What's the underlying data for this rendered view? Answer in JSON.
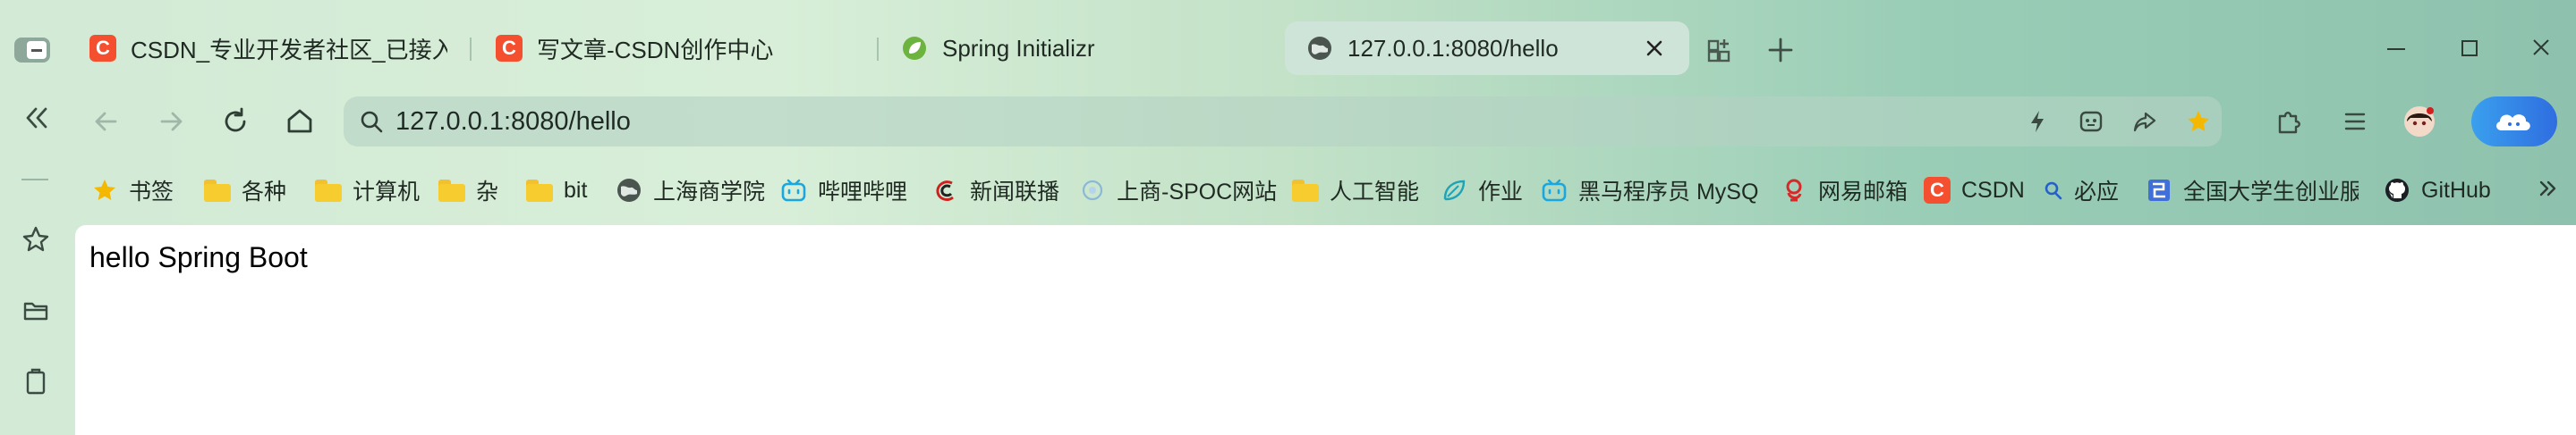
{
  "tabs": [
    {
      "label": "CSDN_专业开发者社区_已接入D",
      "icon": "csdn-icon",
      "active": false
    },
    {
      "label": "写文章-CSDN创作中心",
      "icon": "csdn-icon",
      "active": false
    },
    {
      "label": "Spring Initializr",
      "icon": "spring-leaf-icon",
      "active": false
    },
    {
      "label": "127.0.0.1:8080/hello",
      "icon": "globe-icon",
      "active": true
    }
  ],
  "csdn_letter": "C",
  "address_bar": {
    "url": "127.0.0.1:8080/hello"
  },
  "bookmarks": [
    {
      "label": "书签",
      "icon": "star-icon"
    },
    {
      "label": "各种",
      "icon": "folder-icon"
    },
    {
      "label": "计算机",
      "icon": "folder-icon"
    },
    {
      "label": "杂",
      "icon": "folder-icon"
    },
    {
      "label": "bit",
      "icon": "folder-icon"
    },
    {
      "label": "上海商学院",
      "icon": "globe-icon"
    },
    {
      "label": "哔哩哔哩",
      "icon": "bilibili-icon"
    },
    {
      "label": "新闻联播",
      "icon": "cctv-icon"
    },
    {
      "label": "上商-SPOC网站",
      "icon": "spoc-icon"
    },
    {
      "label": "人工智能",
      "icon": "folder-icon"
    },
    {
      "label": "作业",
      "icon": "leaf-icon"
    },
    {
      "label": "黑马程序员 MySQ",
      "icon": "bilibili-icon"
    },
    {
      "label": "网易邮箱",
      "icon": "netease-mail-icon"
    },
    {
      "label": "CSDN",
      "icon": "csdn-icon"
    },
    {
      "label": "必应",
      "icon": "search-icon"
    },
    {
      "label": "全国大学生创业服",
      "icon": "square-logo-icon"
    },
    {
      "label": "GitHub",
      "icon": "github-icon"
    }
  ],
  "page": {
    "content": "hello Spring Boot"
  },
  "colors": {
    "accent": "#2f6de0",
    "csdn": "#f4502f",
    "star": "#f5b800",
    "bilibili": "#1aa7e0"
  }
}
